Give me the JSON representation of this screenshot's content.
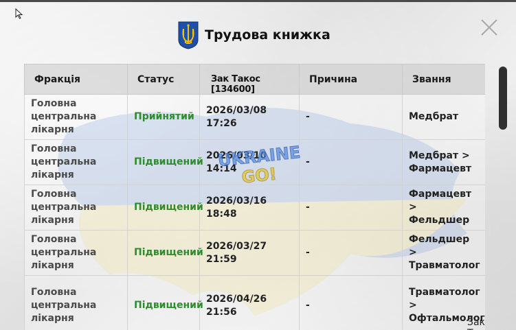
{
  "window": {
    "title": "Трудова книжка"
  },
  "table": {
    "headers": {
      "faction": "Фракція",
      "status": "Статус",
      "date_overlay": "Зак Такос [134600]",
      "reason": "Причина",
      "rank": "Звання"
    },
    "rows": [
      {
        "faction": "Головна центральна лікарня",
        "status": "Прийнятий",
        "date": "2026/03/08 17:26",
        "reason": "-",
        "rank": "Медбрат"
      },
      {
        "faction": "Головна центральна лікарня",
        "status": "Підвищений",
        "date": "2026/03/10 14:14",
        "reason": "-",
        "rank": "Медбрат > Фармацевт"
      },
      {
        "faction": "Головна центральна лікарня",
        "status": "Підвищений",
        "date": "2026/03/16 18:48",
        "reason": "-",
        "rank": "Фармацевт > Фельдшер"
      },
      {
        "faction": "Головна центральна лікарня",
        "status": "Підвищений",
        "date": "2026/03/27 21:59",
        "reason": "-",
        "rank": "Фельдшер > Травматолог"
      },
      {
        "faction": "Головна центральна лікарня",
        "status": "Підвищений",
        "date": "2026/04/26 21:56",
        "reason": "-",
        "rank": "Травматолог > Офтальмолог"
      }
    ]
  },
  "footer": {
    "player_name": "Зак Такос"
  },
  "logo": {
    "line1": "UKRAINE",
    "line2": "GO!"
  },
  "icons": {
    "close": "close-icon",
    "emblem": "trident-icon",
    "cursor": "mouse-cursor-icon"
  },
  "colors": {
    "status_green": "#2e8b2e",
    "emblem_blue": "#1f4fa8",
    "emblem_gold": "#f2c200"
  }
}
